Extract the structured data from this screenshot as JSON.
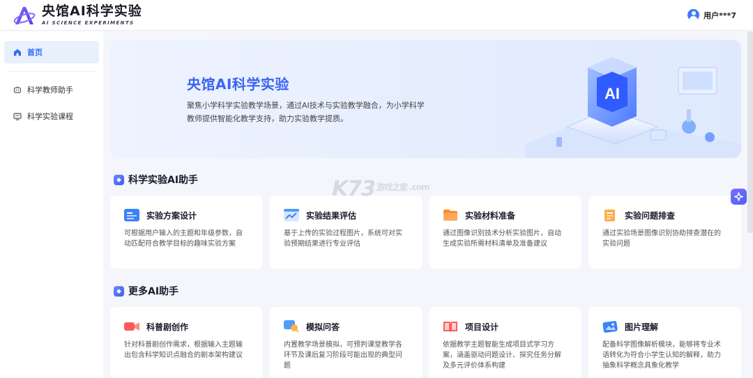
{
  "header": {
    "brand_title": "央馆AI科学实验",
    "brand_subtitle": "AI SCIENCE EXPERIMENTS",
    "user_name": "用户***7"
  },
  "sidebar": {
    "items": [
      {
        "label": "首页",
        "icon": "home-icon",
        "active": true
      },
      {
        "label": "科学教师助手",
        "icon": "robot-icon",
        "active": false
      },
      {
        "label": "科学实验课程",
        "icon": "monitor-icon",
        "active": false
      }
    ]
  },
  "banner": {
    "title": "央馆AI科学实验",
    "description": "聚焦小学科学实验教学场景，通过AI技术与实验教学融合，为小学科学教师提供智能化教学支持，助力实验教学提质。",
    "art_label": "AI"
  },
  "sections": [
    {
      "title": "科学实验AI助手",
      "cards": [
        {
          "title": "实验方案设计",
          "desc": "可根据用户输入的主题和年级参数，自动匹配符合教学目标的趣味实验方案",
          "icon": "document-list-icon",
          "color": "#3b82f6"
        },
        {
          "title": "实验结果评估",
          "desc": "基于上传的实验过程图片，系统可对实验预期结果进行专业评估",
          "icon": "chart-window-icon",
          "color": "#4f9cf9"
        },
        {
          "title": "实验材料准备",
          "desc": "通过图像识别技术分析实验图片，自动生成实验所需材料清单及准备建议",
          "icon": "folder-icon",
          "color": "#ff8a2a"
        },
        {
          "title": "实验问题排查",
          "desc": "通过实验场景图像识别协助排查潜在的实验问题",
          "icon": "clipboard-icon",
          "color": "#ffab4a"
        }
      ]
    },
    {
      "title": "更多AI助手",
      "cards": [
        {
          "title": "科普剧创作",
          "desc": "针对科普剧创作需求，根据输入主题输出包含科学知识点融合的剧本架构建议",
          "icon": "video-camera-icon",
          "color": "#ff5a5a"
        },
        {
          "title": "模拟问答",
          "desc": "内置教学场景模拟，可预判课堂教学各环节及课后复习阶段可能出现的典型问题",
          "icon": "chat-search-icon",
          "color": "#4f9cf9"
        },
        {
          "title": "项目设计",
          "desc": "依据教学主题智能生成项目式学习方案，涵盖驱动问题设计、探究任务分解及多元评价体系构建",
          "icon": "book-icon",
          "color": "#ff5a5a"
        },
        {
          "title": "图片理解",
          "desc": "配备科学图像解析模块，能够将专业术语转化为符合小学生认知的解释，助力抽象科学概念具象化教学",
          "icon": "image-icon",
          "color": "#3b82f6"
        }
      ]
    }
  ],
  "watermark": {
    "text": "K73",
    "sub": "游戏之家 .com"
  }
}
